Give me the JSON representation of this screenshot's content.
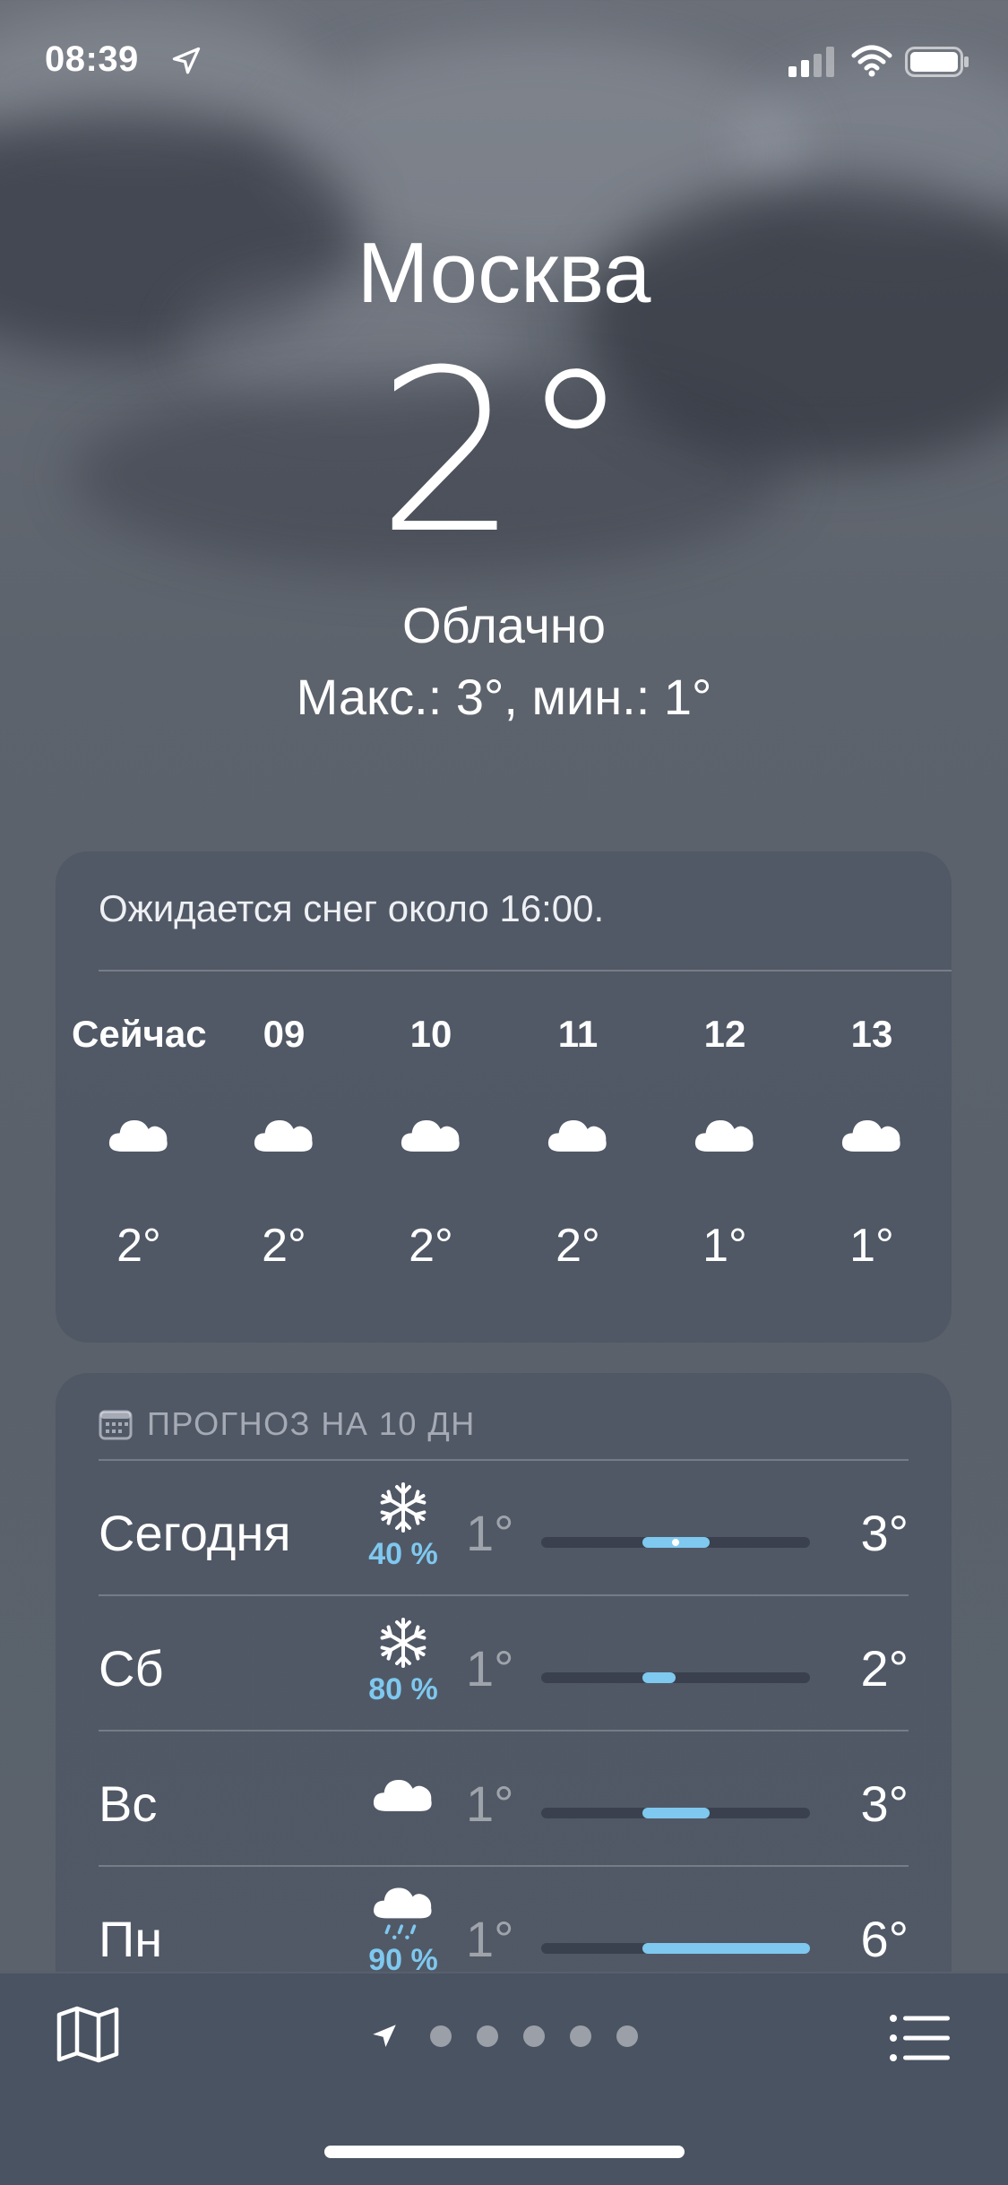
{
  "status_bar": {
    "time": "08:39"
  },
  "header": {
    "city": "Москва",
    "temperature": "2°",
    "condition": "Облачно",
    "high_low": "Макс.: 3°, мин.: 1°"
  },
  "hourly": {
    "summary": "Ожидается снег около 16:00.",
    "hours": [
      {
        "label": "Сейчас",
        "icon": "cloud-icon",
        "temp": "2°"
      },
      {
        "label": "09",
        "icon": "cloud-icon",
        "temp": "2°"
      },
      {
        "label": "10",
        "icon": "cloud-icon",
        "temp": "2°"
      },
      {
        "label": "11",
        "icon": "cloud-icon",
        "temp": "2°"
      },
      {
        "label": "12",
        "icon": "cloud-icon",
        "temp": "1°"
      },
      {
        "label": "13",
        "icon": "cloud-icon",
        "temp": "1°"
      }
    ]
  },
  "daily": {
    "header": "ПРОГНОЗ НА 10 ДН",
    "days": [
      {
        "day": "Сегодня",
        "icon": "snowflake-icon",
        "precip": "40 %",
        "low": "1°",
        "high": "3°",
        "range_low": 1,
        "range_high": 3,
        "current": 2
      },
      {
        "day": "Сб",
        "icon": "snowflake-icon",
        "precip": "80 %",
        "low": "1°",
        "high": "2°",
        "range_low": 1,
        "range_high": 2
      },
      {
        "day": "Вс",
        "icon": "cloud-icon",
        "precip": "",
        "low": "1°",
        "high": "3°",
        "range_low": 1,
        "range_high": 3
      },
      {
        "day": "Пн",
        "icon": "cloud-sleet-icon",
        "precip": "90 %",
        "low": "1°",
        "high": "6°",
        "range_low": 1,
        "range_high": 6
      }
    ],
    "scale_min": -2,
    "scale_max": 6
  },
  "colors": {
    "accent": "#7fc8ef",
    "bottom_bar": "#4a5362"
  },
  "bottom_bar": {
    "pages": 5
  }
}
